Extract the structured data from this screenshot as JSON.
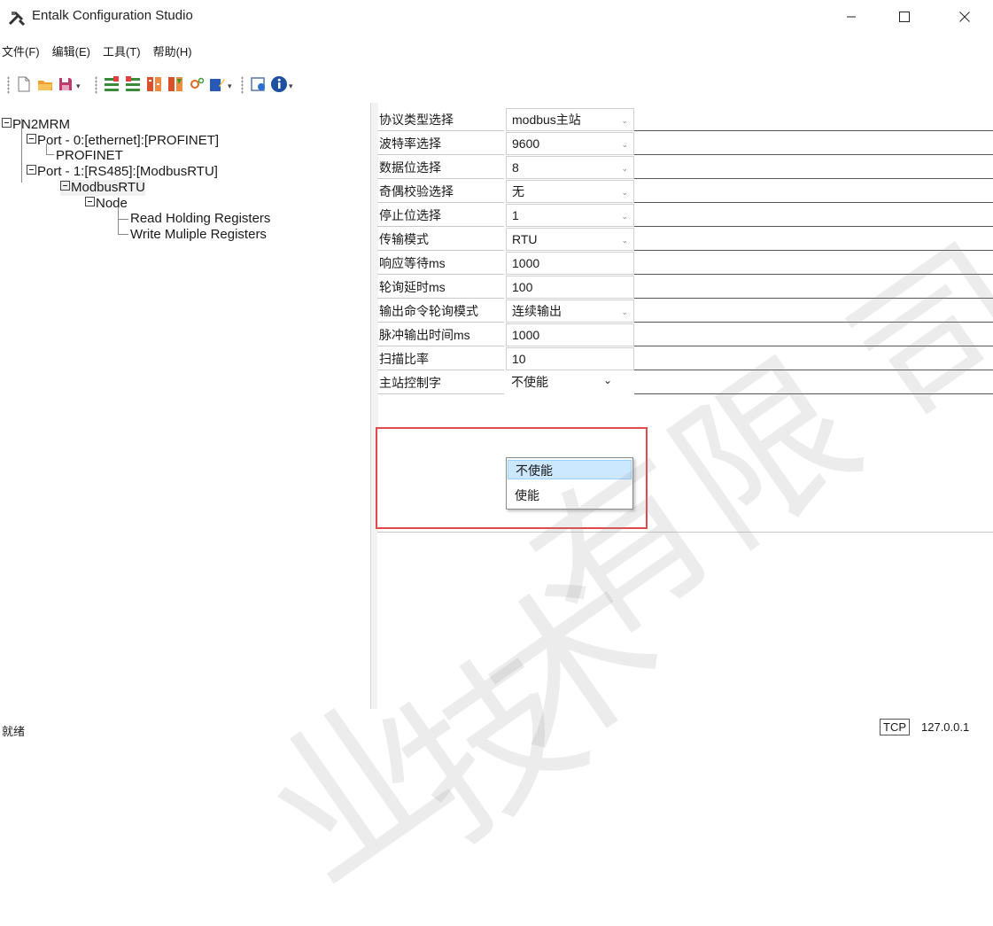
{
  "window": {
    "title": "Entalk Configuration Studio",
    "app_icon": "tools-icon",
    "controls": [
      "minimize-icon",
      "maximize-icon",
      "close-icon"
    ]
  },
  "menu": [
    "文件(F)",
    "编辑(E)",
    "工具(T)",
    "帮助(H)"
  ],
  "toolbar": {
    "icons": [
      "new-file-icon",
      "open-folder-icon",
      "save-icon",
      "add-port-icon",
      "remove-port-icon",
      "read-icon",
      "write-icon",
      "settings-icon",
      "edit-icon",
      "monitor-icon",
      "info-icon"
    ]
  },
  "tree": {
    "root": "PN2MRM",
    "port0": "Port - 0:[ethernet]:[PROFINET]",
    "profinet": "PROFINET",
    "port1": "Port - 1:[RS485]:[ModbusRTU]",
    "modbus": "ModbusRTU",
    "node": "Node",
    "read": "Read Holding Registers",
    "write": "Write Muliple Registers"
  },
  "props": [
    {
      "label": "协议类型选择",
      "value": "modbus主站",
      "combo": true
    },
    {
      "label": "波特率选择",
      "value": "9600",
      "combo": true
    },
    {
      "label": "数据位选择",
      "value": "8",
      "combo": true
    },
    {
      "label": "奇偶校验选择",
      "value": "无",
      "combo": true
    },
    {
      "label": "停止位选择",
      "value": "1",
      "combo": true
    },
    {
      "label": "传输模式",
      "value": "RTU",
      "combo": true
    },
    {
      "label": "响应等待ms",
      "value": "1000",
      "combo": false
    },
    {
      "label": "轮询延时ms",
      "value": "100",
      "combo": false
    },
    {
      "label": "输出命令轮询模式",
      "value": "连续输出",
      "combo": true
    },
    {
      "label": "脉冲输出时间ms",
      "value": "1000",
      "combo": false
    },
    {
      "label": "扫描比率",
      "value": "10",
      "combo": false
    },
    {
      "label": "主站控制字",
      "value": "不使能",
      "combo": true
    }
  ],
  "dropdown": {
    "options": [
      "不使能",
      "使能"
    ],
    "selected": "不使能"
  },
  "status": {
    "text": "就绪",
    "protocol": "TCP",
    "ip": "127.0.0.1"
  },
  "watermark": [
    "司",
    "限",
    "有",
    "术",
    "技",
    "业"
  ],
  "colors": {
    "highlight_box": "#e2494a",
    "selection": "#cce8ff"
  }
}
